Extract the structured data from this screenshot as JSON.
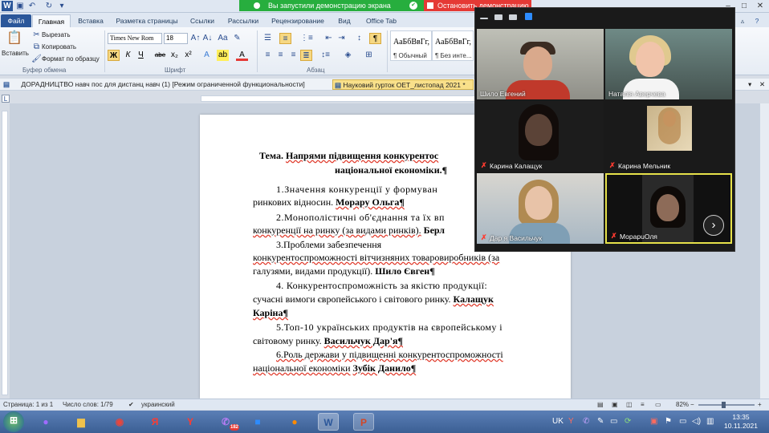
{
  "screen_share": {
    "notice": "Вы запустили демонстрацию экрана",
    "stop_label": "Остановить демонстрацию"
  },
  "ribbon_tabs": [
    "Файл",
    "Главная",
    "Вставка",
    "Разметка страницы",
    "Ссылки",
    "Рассылки",
    "Рецензирование",
    "Вид",
    "Office Tab"
  ],
  "clipboard": {
    "paste": "Вставить",
    "cut": "Вырезать",
    "copy": "Копировать",
    "format_painter": "Формат по образцу",
    "group": "Буфер обмена"
  },
  "font": {
    "family": "Times New Rom",
    "size": "18",
    "group": "Шрифт",
    "bold": "Ж",
    "italic": "К",
    "underline": "Ч",
    "strike": "abe",
    "subscript": "x₂",
    "superscript": "x²"
  },
  "paragraph": {
    "group": "Абзац"
  },
  "styles": [
    {
      "sample": "АаБбВвГг,",
      "name": "¶ Обычный"
    },
    {
      "sample": "АаБбВвГг,",
      "name": "¶ Без инте..."
    }
  ],
  "doc_tabs": [
    "ДОРАДНИЦТВО навч пос для дистанц навч (1) [Режим ограниченной функциональности]",
    "Науковий гурток ОЕТ_листопад 2021 *"
  ],
  "document": {
    "title_line1_prefix": "Тема.",
    "title_line1_rest": "Напрями підвищення конкурентос",
    "title_line2": "національної економіки.¶",
    "items": [
      {
        "lines": [
          "1.Значення конкуренції у формуван",
          "ринкових відносин."
        ],
        "author": "Морару Ольга¶"
      },
      {
        "lines": [
          "2.Монополістичні об'єднання та їх вп",
          "конкуренції на ринку (за видами ринків)."
        ],
        "author": "Берл"
      },
      {
        "lines": [
          "3.Проблеми          забезпечення",
          "конкурентоспроможності вітчизняних товаровиробників (за",
          "галузями, видами продукції)."
        ],
        "author": "Шило Євген¶"
      },
      {
        "lines": [
          "4. Конкурентоспроможність за якістю продукції:",
          "сучасні вимоги європейського і світового ринку.",
          ""
        ],
        "author": "Калащук",
        "author2": "Каріна¶"
      },
      {
        "lines": [
          "5.Топ-10 українських продуктів на європейському і",
          "світовому ринку."
        ],
        "author": "Васильчук Дар'я¶"
      },
      {
        "lines": [
          "6.Роль держави у підвищенні конкурентоспроможності",
          "національної економіки"
        ],
        "author": "Зубік Данило¶"
      }
    ]
  },
  "status": {
    "page": "Страница: 1 из 1",
    "words": "Число слов: 1/79",
    "language": "украинский",
    "zoom": "82%",
    "zoom_level_percent": 82
  },
  "zoom_call": {
    "participants": [
      {
        "name": "Шило Евгений",
        "muted": false
      },
      {
        "name": "Наталія Аверчева",
        "muted": false
      },
      {
        "name": "Карина Калащук",
        "muted": true
      },
      {
        "name": "Карина Мельник",
        "muted": true
      },
      {
        "name": "Дар я Васильчук",
        "muted": true
      },
      {
        "name": "МорарuОля",
        "muted": true
      }
    ]
  },
  "taskbar": {
    "lang": "UK",
    "time": "13:35",
    "date": "10.11.2021",
    "viber_badge": "182"
  },
  "colors": {
    "word_blue": "#2b579a",
    "demo_green": "#27ae3e",
    "stop_red": "#e53935",
    "active_speaker": "#e6e14a"
  }
}
